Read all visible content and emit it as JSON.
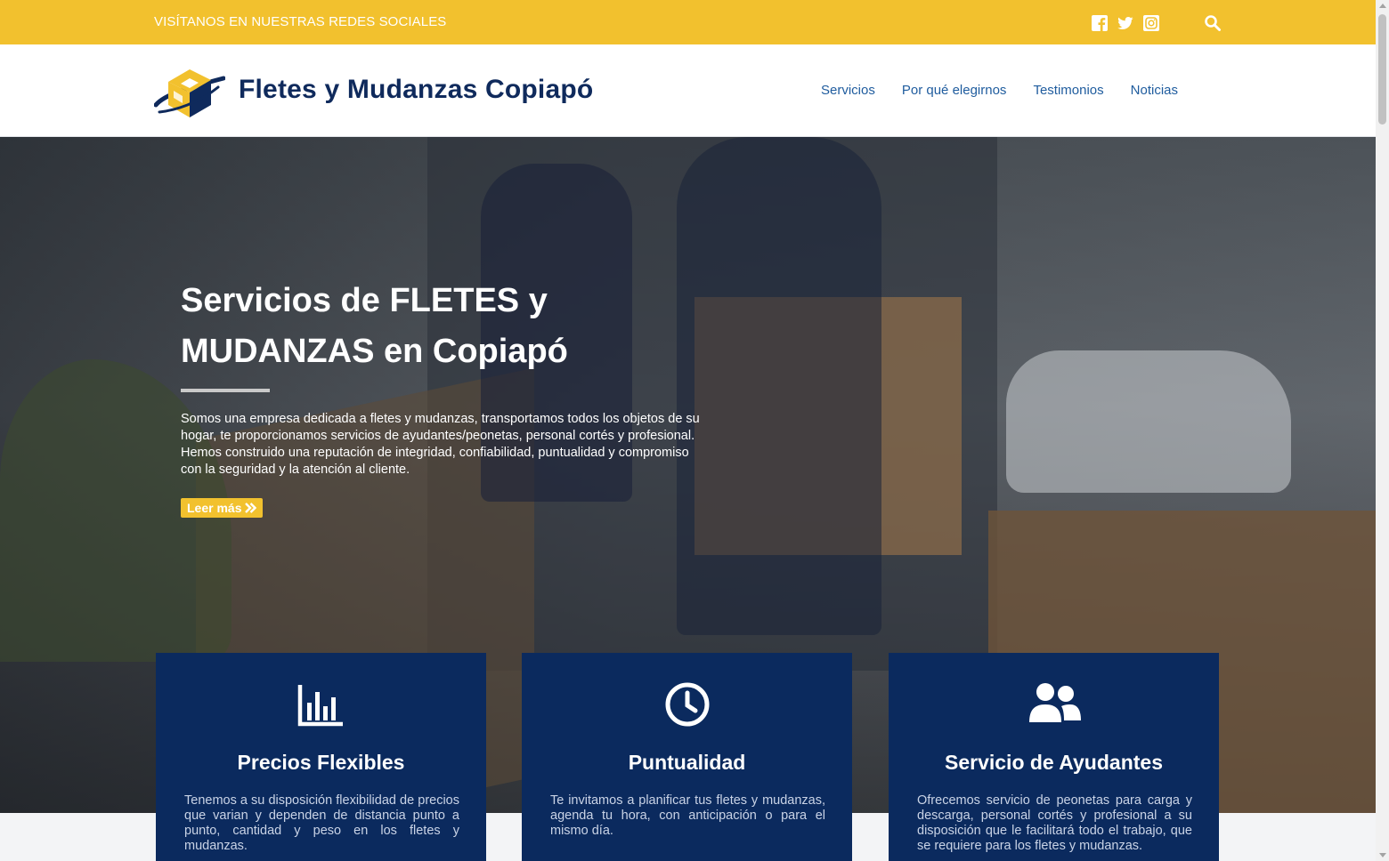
{
  "topbar": {
    "social_text": "VISÍTANOS EN NUESTRAS REDES SOCIALES",
    "icons": [
      "facebook-icon",
      "twitter-icon",
      "instagram-icon"
    ],
    "search_icon": "search-icon"
  },
  "header": {
    "brand": "Fletes y Mudanzas Copiapó",
    "nav": [
      "Servicios",
      "Por qué elegirnos",
      "Testimonios",
      "Noticias"
    ]
  },
  "hero": {
    "title": "Servicios de FLETES y MUDANZAS en Copiapó",
    "description": "Somos una empresa dedicada a fletes y mudanzas, transportamos todos los objetos de su hogar, te proporcionamos servicios de ayudantes/peonetas, personal cortés y profesional. Hemos construido una reputación de integridad, confiabilidad, puntualidad y compromiso con la seguridad y la atención al cliente.",
    "button_label": "Leer más"
  },
  "cards": [
    {
      "icon": "bar-chart-icon",
      "title": "Precios Flexibles",
      "text": "Tenemos a su disposición flexibilidad de precios que varian y dependen de distancia punto a punto, cantidad y peso en los fletes y mudanzas."
    },
    {
      "icon": "clock-icon",
      "title": "Puntualidad",
      "text": "Te invitamos a planificar tus fletes y mudanzas, agenda tu hora, con anticipación o para el mismo día."
    },
    {
      "icon": "users-icon",
      "title": "Servicio de Ayudantes",
      "text": "Ofrecemos servicio de peonetas para carga y descarga, personal cortés y profesional a su disposición que le facilitará todo el trabajo, que se requiere para los fletes y mudanzas."
    }
  ],
  "colors": {
    "accent": "#f2c12e",
    "navy": "#0b2a5e",
    "link": "#1f5c9e"
  }
}
